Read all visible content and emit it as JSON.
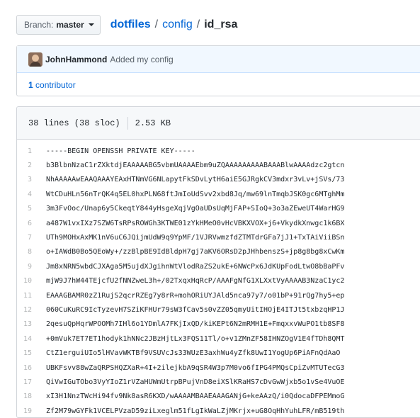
{
  "breadcrumb": {
    "branch_prefix": "Branch:",
    "branch_name": "master",
    "repo": "dotfiles",
    "sep1": "/",
    "folder": "config",
    "sep2": "/",
    "file": "id_rsa"
  },
  "commit": {
    "author": "JohnHammond",
    "message": "Added my config",
    "contributors_count": "1",
    "contributors_label": "contributor"
  },
  "file_info": {
    "lines": "38 lines (38 sloc)",
    "size": "2.53 KB"
  },
  "code_lines": [
    {
      "n": "1",
      "t": "-----BEGIN OPENSSH PRIVATE KEY-----"
    },
    {
      "n": "2",
      "t": "b3BlbnNzaC1rZXktdjEAAAAABG5vbmUAAAAEbm9uZQAAAAAAAAABAAABlwAAAAdzc2gtcn"
    },
    {
      "n": "3",
      "t": "NhAAAAAwEAAQAAAYEAxHTNmVG6NLapytFkSDvLytH6aiE5GJRgkCV3mdxr3vLv+jSVs/73"
    },
    {
      "n": "4",
      "t": "WtCDuHLn56nTrQK4q5EL0hxPLN68ftJmIoUdSvv2xbd8Jq/mw69lnTmqbJSK0gc6MTghMm"
    },
    {
      "n": "5",
      "t": "3m3FvOoc/Unap6y5CkeqtY844yHsgeXqjVgOaUDsUqMjFAP+SIoQ+3o3aZEweUT4WarHG9"
    },
    {
      "n": "6",
      "t": "a487W1vxIXz7SZW6TsRPsROWGh3KTWE01zYkHMeO0vHcVBKXVOX+j6+VkydkXnwgc1k6BX"
    },
    {
      "n": "7",
      "t": "UTh9MOHxAxMK1nV6uC6JQijmUdW9q9YpMF/1VJRVwmzfdZTMTdrGFa7jJ1+TxTAiViiBSn"
    },
    {
      "n": "8",
      "t": "o+IAWdB0Bo5QEoWy+/zzBlpBE9IdBldpH7gj7aKV6ORsD2pJHhbenszS+jp8g8bg8xCwKm"
    },
    {
      "n": "9",
      "t": "Jm8xNRN5wbdCJXAga5M5ujdXJgihnWtVlodRaZS2ukE+6NWcPx6JdKUpFodLtwO8bBaPFv"
    },
    {
      "n": "10",
      "t": "mjW9J7hW44TEjcfU2fNNZweL3h+/02TxqxHqRcP/AAAFgNfG1XLXxtVyAAAAB3NzaC1yc2"
    },
    {
      "n": "11",
      "t": "EAAAGBAMR0zZ1RujS2qcrRZEg7y8rR+mohORiUYJAld5nca97y7/o01bP+91rQg7hy5+ep"
    },
    {
      "n": "12",
      "t": "060CuKuRC9IcTyzevH7SZiKFHUr79sW3fCav5s0vZZ05qmyUitIHOjE4ITJt5txbzqHP1J"
    },
    {
      "n": "13",
      "t": "2qesuQpHqrWPOOMh7IHl6o1YDmlA7FKjIxQD/kiKEPt6N2mRMH1E+FmqxxvWuPO1tb8SF8"
    },
    {
      "n": "14",
      "t": "+0mVuk7ET7ET1hodyk1hNNc2JBzHjtLx3FQS11Tl/o+v1ZMnZF58IHNZOgV1E4fTDh8QMT"
    },
    {
      "n": "15",
      "t": "CtZ1erguiUIo5lHVavWKTBf9VSUVcJs33WUzE3axhWu4yZfk8UwI1YogUp6PiAFnQdAaO"
    },
    {
      "n": "16",
      "t": "UBKFsvv88wZaQRPSHQZXaR+4I+2ilejkbA9qSR4W3p7M0vo6fIPG4PMQsCpiZvMTUTecG3"
    },
    {
      "n": "17",
      "t": "QiVwIGuTObo3VyYIoZ1rVZaHUWmUtrpBPujVnD8eiXSlKRaHS7cDvGwWjxb5o1vSe4VuOE"
    },
    {
      "n": "18",
      "t": "xI3H1NnzTWcHi94fv9Nk8asR6KXD/wAAAAMBAAEAAAGANjG+keAAzQ/i0QdocaDFPEMmoG"
    },
    {
      "n": "19",
      "t": "Zf2M79wGYFk1VCELPVzaD59ziLxeglm51fLgIkWaLZjMKrjx+uG8OqHhYuhLFR/mB519th"
    }
  ],
  "colors": {
    "link": "#0366d6",
    "commit_bg": "#f1f8ff",
    "header_bg": "#f6f8fa",
    "border": "#d1d5da"
  }
}
